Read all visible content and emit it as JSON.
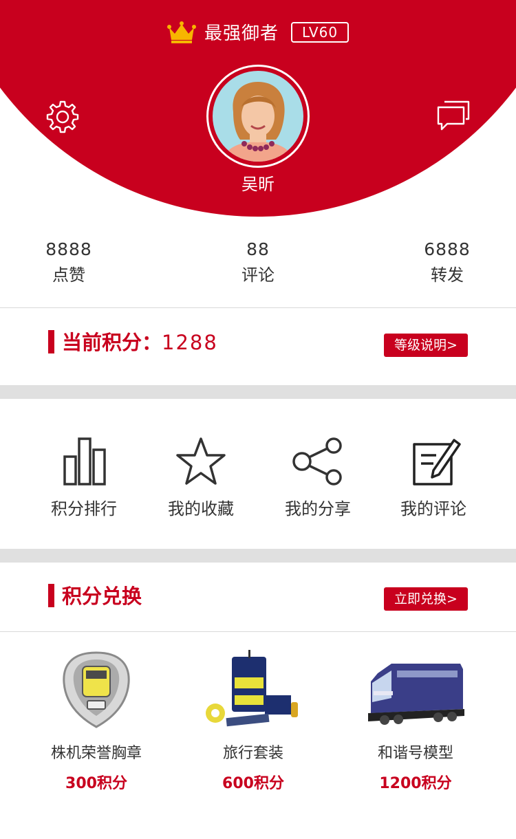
{
  "header": {
    "title": "最强御者",
    "level": "LV60",
    "username": "吴昕",
    "accent_color": "#c8001e"
  },
  "stats": [
    {
      "value": "8888",
      "label": "点赞"
    },
    {
      "value": "88",
      "label": "评论"
    },
    {
      "value": "6888",
      "label": "转发"
    }
  ],
  "points": {
    "title": "当前积分：",
    "value": "1288",
    "button": "等级说明>"
  },
  "menu": [
    {
      "label": "积分排行",
      "icon": "bar-chart-icon"
    },
    {
      "label": "我的收藏",
      "icon": "star-icon"
    },
    {
      "label": "我的分享",
      "icon": "share-icon"
    },
    {
      "label": "我的评论",
      "icon": "edit-icon"
    }
  ],
  "exchange": {
    "title": "积分兑换",
    "button": "立即兑换>",
    "products": [
      {
        "name": "株机荣誉胸章",
        "price": "300积分"
      },
      {
        "name": "旅行套装",
        "price": "600积分"
      },
      {
        "name": "和谐号模型",
        "price": "1200积分"
      }
    ]
  }
}
